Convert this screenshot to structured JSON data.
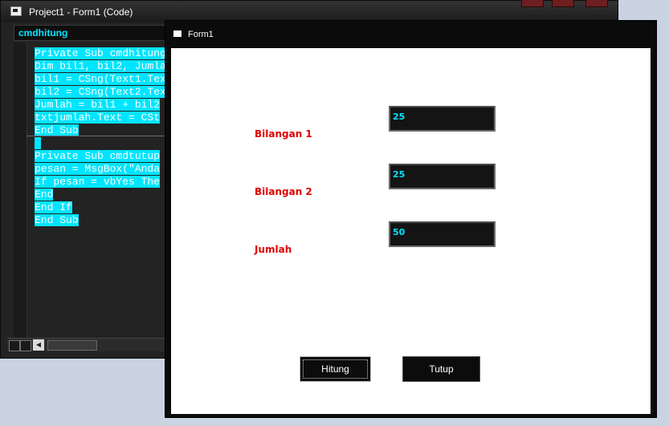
{
  "code_window": {
    "title": "Project1 - Form1 (Code)",
    "object_selector": "cmdhitung",
    "lines": [
      "Private Sub cmdhitung",
      "Dim bil1, bil2, Jumla",
      "bil1 = CSng(Text1.Tex",
      "bil2 = CSng(Text2.Tex",
      "Jumlah = bil1 + bil2",
      "txtjumlah.Text = CSt",
      "End Sub",
      " ",
      "Private Sub cmdtutup",
      "pesan = MsgBox(\"Anda",
      "If pesan = vbYes The",
      "End",
      "End If",
      "End Sub"
    ]
  },
  "form_window": {
    "title": "Form1",
    "fields": [
      {
        "label": "Bilangan 1",
        "value": "25"
      },
      {
        "label": "Bilangan 2",
        "value": "25"
      },
      {
        "label": "Jumlah",
        "value": "50"
      }
    ],
    "buttons": {
      "hitung": "Hitung",
      "tutup": "Tutup"
    }
  },
  "colors": {
    "accent_cyan": "#00e5ff",
    "label_red": "#e00000",
    "background_dark": "#0b0b0b"
  },
  "icons": {
    "code_window_icon": "code-window-icon",
    "form_window_icon": "form-icon"
  }
}
